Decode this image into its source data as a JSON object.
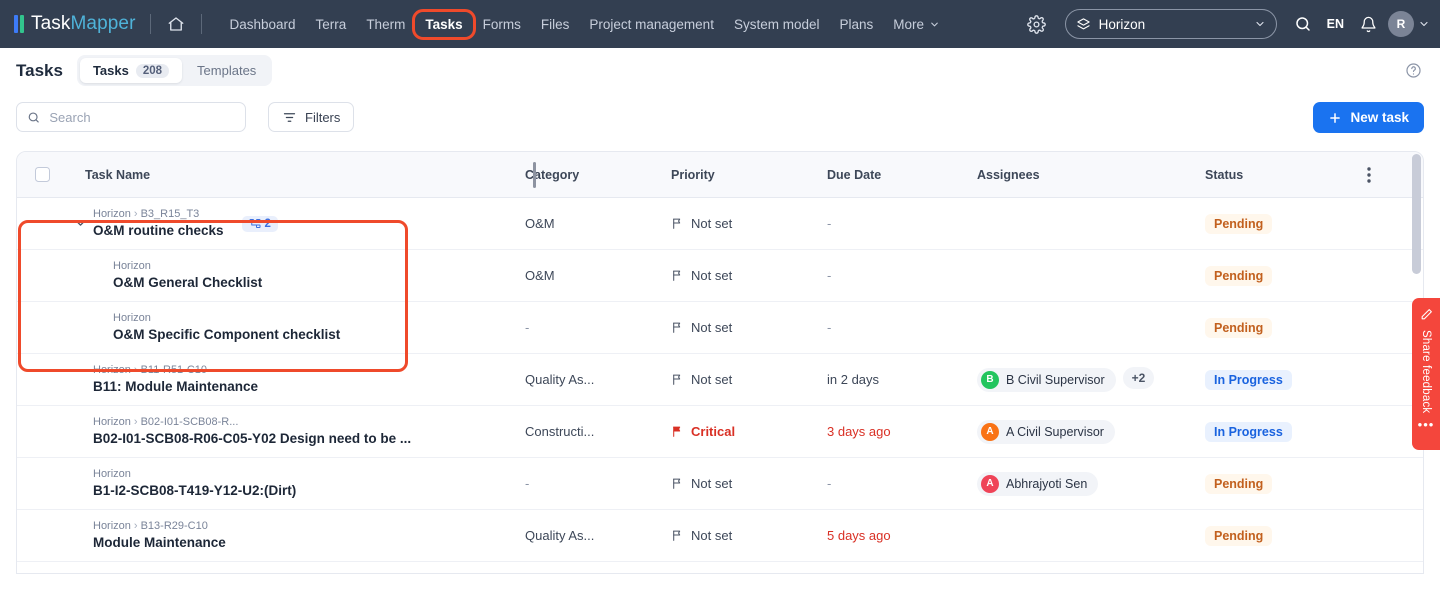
{
  "app": {
    "brand_primary": "TaskMapper",
    "brand_part1": "Task",
    "brand_part2": "Mapper",
    "accent_blue": "#1a73f0",
    "highlight_red": "#ef4a2b",
    "navbar_bg": "#333f51"
  },
  "topnav": {
    "home_icon": "home-icon",
    "links": [
      {
        "label": "Dashboard",
        "active": false
      },
      {
        "label": "Terra",
        "active": false
      },
      {
        "label": "Therm",
        "active": false
      },
      {
        "label": "Tasks",
        "active": true,
        "highlighted": true
      },
      {
        "label": "Forms",
        "active": false
      },
      {
        "label": "Files",
        "active": false
      },
      {
        "label": "Project management",
        "active": false
      },
      {
        "label": "System model",
        "active": false
      },
      {
        "label": "Plans",
        "active": false
      }
    ],
    "more_label": "More",
    "settings_icon": "gear-icon",
    "project_selector": {
      "value": "Horizon",
      "icon": "layers-icon",
      "chevron": "chevron-down-icon"
    },
    "search_icon": "search-icon",
    "language": "EN",
    "notifications_icon": "bell-icon",
    "avatar_initial": "R"
  },
  "page_header": {
    "title": "Tasks",
    "tabs": [
      {
        "label": "Tasks",
        "count": "208",
        "active": true
      },
      {
        "label": "Templates",
        "count": null,
        "active": false
      }
    ],
    "help_icon": "help-circle-icon"
  },
  "toolbar": {
    "search_placeholder": "Search",
    "search_value": "",
    "filters_label": "Filters",
    "new_task_label": "New task"
  },
  "table": {
    "columns": [
      "Task Name",
      "Category",
      "Priority",
      "Due Date",
      "Assignees",
      "Status"
    ],
    "kebab_icon": "more-vertical-icon",
    "rows": [
      {
        "indent": false,
        "expanded": true,
        "has_caret": true,
        "breadcrumb_root": "Horizon",
        "breadcrumb_leaf": "B3_R15_T3",
        "title": "O&M routine checks",
        "subtask_count": "2",
        "category": "O&M",
        "priority": "Not set",
        "priority_critical": false,
        "due_date": "-",
        "due_overdue": false,
        "assignees": [],
        "extra_assignees": null,
        "status": "Pending",
        "status_kind": "pending"
      },
      {
        "indent": true,
        "expanded": false,
        "has_caret": false,
        "breadcrumb_root": "Horizon",
        "breadcrumb_leaf": null,
        "title": "O&M General Checklist",
        "subtask_count": null,
        "category": "O&M",
        "priority": "Not set",
        "priority_critical": false,
        "due_date": "-",
        "due_overdue": false,
        "assignees": [],
        "extra_assignees": null,
        "status": "Pending",
        "status_kind": "pending"
      },
      {
        "indent": true,
        "expanded": false,
        "has_caret": false,
        "breadcrumb_root": "Horizon",
        "breadcrumb_leaf": null,
        "title": "O&M Specific Component checklist",
        "subtask_count": null,
        "category": "-",
        "priority": "Not set",
        "priority_critical": false,
        "due_date": "-",
        "due_overdue": false,
        "assignees": [],
        "extra_assignees": null,
        "status": "Pending",
        "status_kind": "pending"
      },
      {
        "indent": false,
        "expanded": false,
        "has_caret": false,
        "breadcrumb_root": "Horizon",
        "breadcrumb_leaf": "B11-R51-C10",
        "title": "B11: Module Maintenance",
        "subtask_count": null,
        "category": "Quality As...",
        "priority": "Not set",
        "priority_critical": false,
        "due_date": "in 2 days",
        "due_overdue": false,
        "assignees": [
          {
            "name": "B Civil Supervisor",
            "initial": "B",
            "color": "#22c55e"
          }
        ],
        "extra_assignees": "+2",
        "status": "In Progress",
        "status_kind": "inprogress"
      },
      {
        "indent": false,
        "expanded": false,
        "has_caret": false,
        "breadcrumb_root": "Horizon",
        "breadcrumb_leaf": "B02-I01-SCB08-R...",
        "title": "B02-I01-SCB08-R06-C05-Y02 Design need to be ...",
        "subtask_count": null,
        "category": "Constructi...",
        "priority": "Critical",
        "priority_critical": true,
        "due_date": "3 days ago",
        "due_overdue": true,
        "assignees": [
          {
            "name": "A Civil Supervisor",
            "initial": "A",
            "color": "#f97316"
          }
        ],
        "extra_assignees": null,
        "status": "In Progress",
        "status_kind": "inprogress"
      },
      {
        "indent": false,
        "expanded": false,
        "has_caret": false,
        "breadcrumb_root": "Horizon",
        "breadcrumb_leaf": null,
        "title": "B1-I2-SCB08-T419-Y12-U2:(Dirt)",
        "subtask_count": null,
        "category": "-",
        "priority": "Not set",
        "priority_critical": false,
        "due_date": "-",
        "due_overdue": false,
        "assignees": [
          {
            "name": "Abhrajyoti Sen",
            "initial": "A",
            "color": "#ef4458"
          }
        ],
        "extra_assignees": null,
        "status": "Pending",
        "status_kind": "pending"
      },
      {
        "indent": false,
        "expanded": false,
        "has_caret": false,
        "breadcrumb_root": "Horizon",
        "breadcrumb_leaf": "B13-R29-C10",
        "title": "Module Maintenance",
        "subtask_count": null,
        "category": "Quality As...",
        "priority": "Not set",
        "priority_critical": false,
        "due_date": "5 days ago",
        "due_overdue": true,
        "assignees": [],
        "extra_assignees": null,
        "status": "Pending",
        "status_kind": "pending"
      }
    ]
  },
  "feedback_tab": {
    "label": "Share feedback",
    "icon": "pencil-icon",
    "dots": "•••"
  }
}
